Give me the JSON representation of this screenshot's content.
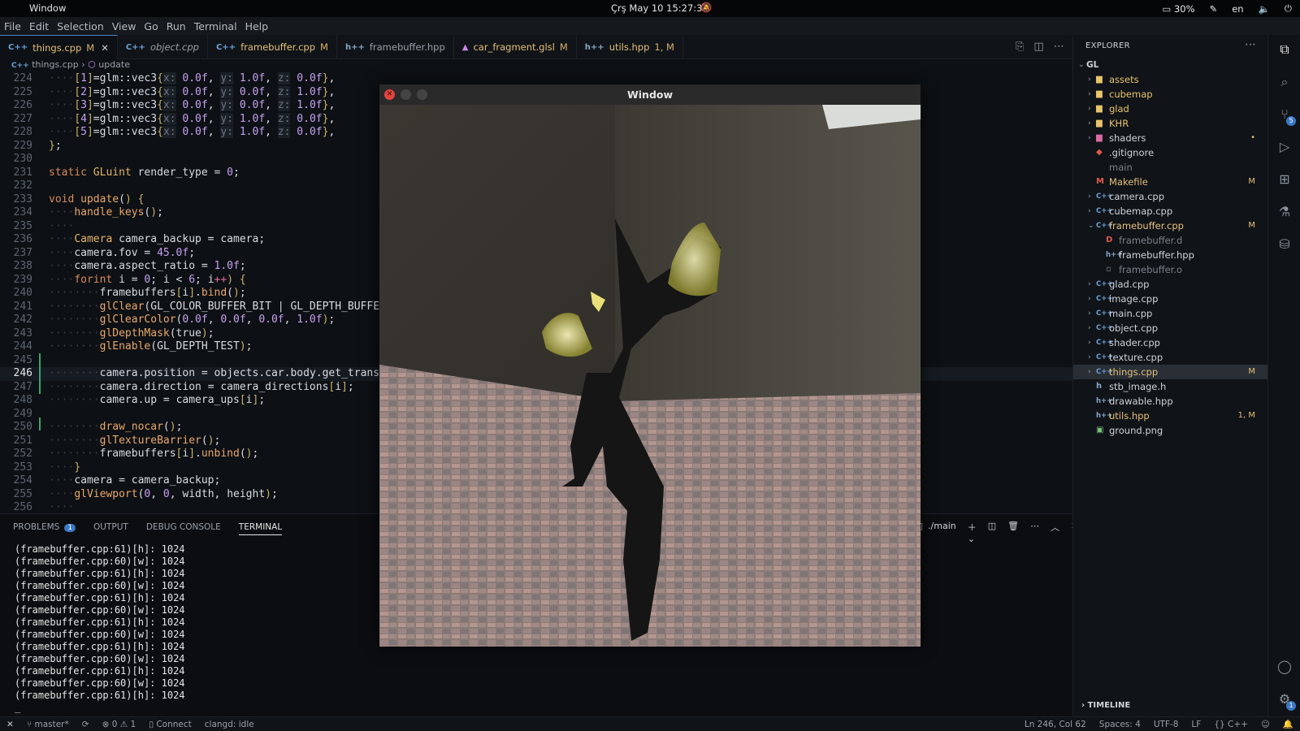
{
  "topbar": {
    "app_name": "Window",
    "clock": "Çrş May 10  15:27:34",
    "battery": "30%",
    "lang": "en"
  },
  "menu": [
    "File",
    "Edit",
    "Selection",
    "View",
    "Go",
    "Run",
    "Terminal",
    "Help"
  ],
  "tabs": [
    {
      "icon": "C++",
      "name": "things.cpp",
      "status": "M",
      "active": true,
      "italic": false
    },
    {
      "icon": "C++",
      "name": "object.cpp",
      "status": "",
      "active": false,
      "italic": true
    },
    {
      "icon": "C++",
      "name": "framebuffer.cpp",
      "status": "M",
      "active": false,
      "italic": false
    },
    {
      "icon": "h++",
      "name": "framebuffer.hpp",
      "status": "",
      "active": false,
      "italic": false
    },
    {
      "icon": "glsl",
      "name": "car_fragment.glsl",
      "status": "M",
      "active": false,
      "italic": false
    },
    {
      "icon": "h++",
      "name": "utils.hpp",
      "status": "1, M",
      "active": false,
      "italic": false
    }
  ],
  "breadcrumb": {
    "file": "things.cpp",
    "symbol": "update"
  },
  "editor": {
    "lines": [
      {
        "n": "224",
        "t": "    [1]=glm::vec3{x: 0.0f, y: 1.0f, z: 0.0f},"
      },
      {
        "n": "225",
        "t": "    [2]=glm::vec3{x: 0.0f, y: 0.0f, z: 1.0f},"
      },
      {
        "n": "226",
        "t": "    [3]=glm::vec3{x: 0.0f, y: 0.0f, z: 1.0f},"
      },
      {
        "n": "227",
        "t": "    [4]=glm::vec3{x: 0.0f, y: 1.0f, z: 0.0f},"
      },
      {
        "n": "228",
        "t": "    [5]=glm::vec3{x: 0.0f, y: 1.0f, z: 0.0f},"
      },
      {
        "n": "229",
        "t": "};"
      },
      {
        "n": "230",
        "t": ""
      },
      {
        "n": "231",
        "t": "static GLuint render_type = 0;"
      },
      {
        "n": "232",
        "t": ""
      },
      {
        "n": "233",
        "t": "void update() {"
      },
      {
        "n": "234",
        "t": "    handle_keys();"
      },
      {
        "n": "235",
        "t": "    "
      },
      {
        "n": "236",
        "t": "    Camera camera_backup = camera;"
      },
      {
        "n": "237",
        "t": "    camera.fov = 45.0f;"
      },
      {
        "n": "238",
        "t": "    camera.aspect_ratio = 1.0f;"
      },
      {
        "n": "239",
        "t": "    for(int i = 0; i < 6; i++) {"
      },
      {
        "n": "240",
        "t": "        framebuffers[i].bind();"
      },
      {
        "n": "241",
        "t": "        glClear(GL_COLOR_BUFFER_BIT | GL_DEPTH_BUFFER_"
      },
      {
        "n": "242",
        "t": "        glClearColor(0.0f, 0.0f, 0.0f, 1.0f);"
      },
      {
        "n": "243",
        "t": "        glDepthMask(true);"
      },
      {
        "n": "244",
        "t": "        glEnable(GL_DEPTH_TEST);"
      },
      {
        "n": "245",
        "t": ""
      },
      {
        "n": "246",
        "t": "        camera.position = objects.car.body.get_transla"
      },
      {
        "n": "247",
        "t": "        camera.direction = camera_directions[i];"
      },
      {
        "n": "248",
        "t": "        camera.up = camera_ups[i];"
      },
      {
        "n": "249",
        "t": ""
      },
      {
        "n": "250",
        "t": "        draw_nocar();"
      },
      {
        "n": "251",
        "t": "        glTextureBarrier();"
      },
      {
        "n": "252",
        "t": "        framebuffers[i].unbind();"
      },
      {
        "n": "253",
        "t": "    }"
      },
      {
        "n": "254",
        "t": "    camera = camera_backup;"
      },
      {
        "n": "255",
        "t": "    glViewport(0, 0, width, height);"
      },
      {
        "n": "256",
        "t": "    "
      }
    ],
    "current_line": "246"
  },
  "panel": {
    "tabs": [
      "PROBLEMS",
      "OUTPUT",
      "DEBUG CONSOLE",
      "TERMINAL"
    ],
    "problems_count": "1",
    "active": "TERMINAL",
    "terminal_name": "./main",
    "terminal_lines": [
      "(framebuffer.cpp:61)[h]: 1024",
      "(framebuffer.cpp:60)[w]: 1024",
      "(framebuffer.cpp:61)[h]: 1024",
      "(framebuffer.cpp:60)[w]: 1024",
      "(framebuffer.cpp:61)[h]: 1024",
      "(framebuffer.cpp:60)[w]: 1024",
      "(framebuffer.cpp:61)[h]: 1024",
      "(framebuffer.cpp:60)[w]: 1024",
      "(framebuffer.cpp:61)[h]: 1024",
      "(framebuffer.cpp:60)[w]: 1024",
      "(framebuffer.cpp:61)[h]: 1024",
      "(framebuffer.cpp:60)[w]: 1024",
      "(framebuffer.cpp:61)[h]: 1024",
      "_"
    ]
  },
  "gl_window": {
    "title": "Window"
  },
  "explorer": {
    "title": "EXPLORER",
    "root": "GL",
    "timeline": "TIMELINE",
    "items": [
      {
        "kind": "folder",
        "name": "assets",
        "depth": 1,
        "expanded": false,
        "status": "",
        "color": "folder"
      },
      {
        "kind": "folder",
        "name": "cubemap",
        "depth": 1,
        "expanded": false,
        "status": "",
        "color": "folder"
      },
      {
        "kind": "folder",
        "name": "glad",
        "depth": 1,
        "expanded": false,
        "status": "",
        "color": "folder"
      },
      {
        "kind": "folder",
        "name": "KHR",
        "depth": 1,
        "expanded": false,
        "status": "",
        "color": "folder"
      },
      {
        "kind": "folder",
        "name": "shaders",
        "depth": 1,
        "expanded": false,
        "status": "•",
        "color": "pink"
      },
      {
        "kind": "file",
        "name": ".gitignore",
        "depth": 1,
        "icon": "◆",
        "status": "",
        "color": ""
      },
      {
        "kind": "file",
        "name": "main",
        "depth": 1,
        "icon": "",
        "status": "",
        "color": "dim"
      },
      {
        "kind": "file",
        "name": "Makefile",
        "depth": 1,
        "icon": "M",
        "status": "M",
        "color": "mod"
      },
      {
        "kind": "cfolder",
        "name": "camera.cpp",
        "depth": 1,
        "expanded": false,
        "status": "",
        "color": ""
      },
      {
        "kind": "cfolder",
        "name": "cubemap.cpp",
        "depth": 1,
        "expanded": false,
        "status": "",
        "color": ""
      },
      {
        "kind": "cfolder",
        "name": "framebuffer.cpp",
        "depth": 1,
        "expanded": true,
        "status": "M",
        "color": "mod"
      },
      {
        "kind": "file",
        "name": "framebuffer.d",
        "depth": 2,
        "icon": "D",
        "status": "",
        "color": "dim"
      },
      {
        "kind": "file",
        "name": "framebuffer.hpp",
        "depth": 2,
        "icon": "h++",
        "status": "",
        "color": ""
      },
      {
        "kind": "file",
        "name": "framebuffer.o",
        "depth": 2,
        "icon": "▫",
        "status": "",
        "color": "dim"
      },
      {
        "kind": "cfolder",
        "name": "glad.cpp",
        "depth": 1,
        "expanded": false,
        "status": "",
        "color": ""
      },
      {
        "kind": "cfolder",
        "name": "image.cpp",
        "depth": 1,
        "expanded": false,
        "status": "",
        "color": ""
      },
      {
        "kind": "cfolder",
        "name": "main.cpp",
        "depth": 1,
        "expanded": false,
        "status": "",
        "color": ""
      },
      {
        "kind": "cfolder",
        "name": "object.cpp",
        "depth": 1,
        "expanded": false,
        "status": "",
        "color": ""
      },
      {
        "kind": "cfolder",
        "name": "shader.cpp",
        "depth": 1,
        "expanded": false,
        "status": "",
        "color": ""
      },
      {
        "kind": "cfolder",
        "name": "texture.cpp",
        "depth": 1,
        "expanded": false,
        "status": "",
        "color": ""
      },
      {
        "kind": "cfolder",
        "name": "things.cpp",
        "depth": 1,
        "expanded": false,
        "status": "M",
        "color": "mod",
        "selected": true
      },
      {
        "kind": "file",
        "name": "stb_image.h",
        "depth": 1,
        "icon": "h",
        "status": "",
        "color": ""
      },
      {
        "kind": "file",
        "name": "drawable.hpp",
        "depth": 1,
        "icon": "h++",
        "status": "",
        "color": ""
      },
      {
        "kind": "file",
        "name": "utils.hpp",
        "depth": 1,
        "icon": "h++",
        "status": "1, M",
        "color": "mod"
      },
      {
        "kind": "file",
        "name": "ground.png",
        "depth": 1,
        "icon": "▣",
        "status": "",
        "color": ""
      }
    ]
  },
  "statusbar": {
    "branch": "master*",
    "errors": "0",
    "warnings": "1",
    "connect": "Connect",
    "clangd": "clangd: idle",
    "position": "Ln 246, Col 62",
    "spaces": "Spaces: 4",
    "encoding": "UTF-8",
    "eol": "LF",
    "language": "C++"
  },
  "activity_badges": {
    "scm": "5",
    "settings": "1"
  }
}
